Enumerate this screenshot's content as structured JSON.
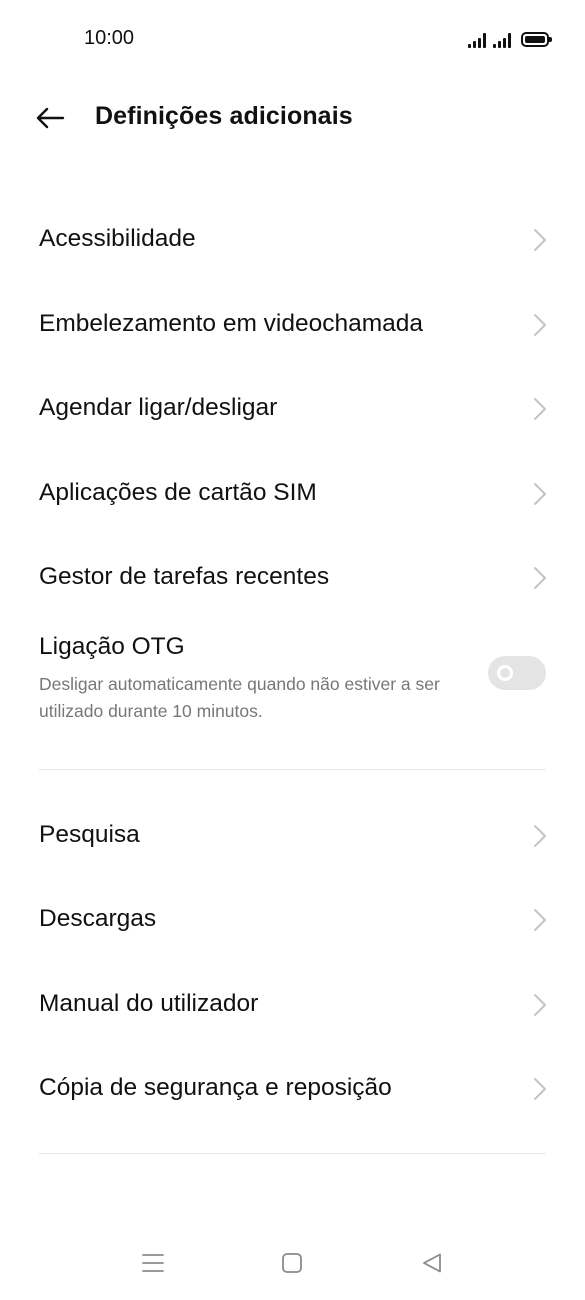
{
  "status_bar": {
    "time": "10:00"
  },
  "header": {
    "title": "Definições adicionais"
  },
  "group1": [
    {
      "label": "Acessibilidade"
    },
    {
      "label": "Embelezamento em videochamada"
    },
    {
      "label": "Agendar ligar/desligar"
    },
    {
      "label": "Aplicações de cartão SIM"
    },
    {
      "label": "Gestor de tarefas recentes"
    }
  ],
  "otg": {
    "title": "Ligação OTG",
    "subtitle": "Desligar automaticamente quando não estiver a ser utilizado durante 10 minutos.",
    "enabled": false
  },
  "group2": [
    {
      "label": "Pesquisa"
    },
    {
      "label": "Descargas"
    },
    {
      "label": "Manual do utilizador"
    },
    {
      "label": "Cópia de segurança e reposição"
    }
  ],
  "colors": {
    "text": "#111111",
    "secondary_text": "#777777",
    "divider": "#e6e6e6",
    "toggle_off": "#e4e4e4",
    "chevron": "#c4c4c4"
  },
  "icons": [
    "back-arrow-icon",
    "chevron-right-icon",
    "menu-icon",
    "home-icon",
    "back-triangle-icon"
  ]
}
